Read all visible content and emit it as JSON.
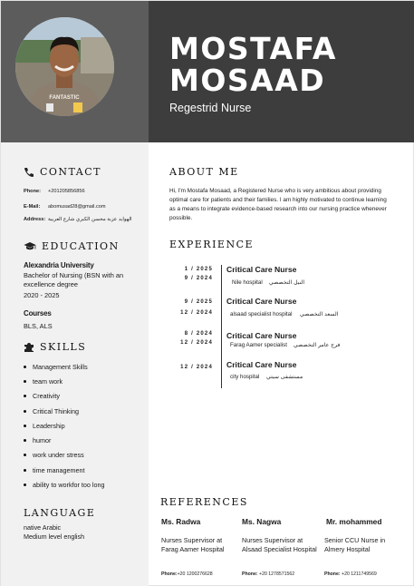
{
  "header": {
    "first_name": "MOSTAFA",
    "last_name": "MOSAAD",
    "job_title": "Regestrid Nurse",
    "photo_shirt_text": "FANTASTIC"
  },
  "contact": {
    "title": "CONTACT",
    "phone_label": "Phone:",
    "phone": "+201205856856",
    "email_label": "E-Mail:",
    "email": "abomusad28@gmail.com",
    "address_label": "Address:",
    "address": "الهوايد عزبة محسن الكبري شارع العربية"
  },
  "education": {
    "title": "EDUCATION",
    "school": "Alexandria University",
    "degree": "Bachelor of Nursing (BSN with an excellence degree",
    "years": "2020 - 2025",
    "courses_title": "Courses",
    "courses": "BLS, ALS"
  },
  "skills": {
    "title": "SKILLS",
    "items": [
      "Management Skills",
      "team work",
      "Creativity",
      "Critical Thinking",
      "Leadership",
      "humor",
      "work under stress",
      "time management",
      "ability to workfor too long"
    ]
  },
  "language": {
    "title": "LANGUAGE",
    "native": "native Arabic",
    "other": "Medium level english"
  },
  "about": {
    "title": "ABOUT ME",
    "text": "Hi, I'm Mostafa Mosaad, a Registered Nurse who is very ambitious about providing optimal care for patients and their families. I am highly motivated to continue learning as a means to integrate evidence-based research into our nursing practice whenever possible."
  },
  "experience": {
    "title": "EXPERIENCE",
    "items": [
      {
        "date1": "1 / 2025",
        "date2": "9 / 2024",
        "title": "Critical Care Nurse",
        "place_en": "Nile hospital",
        "place_ar": "النيل التخصصي"
      },
      {
        "date1": "9 / 2025",
        "date2": "12 / 2024",
        "title": "Critical Care Nurse",
        "place_en": "alsaad specialist hospital",
        "place_ar": "السعد التخصصي"
      },
      {
        "date1": "8 / 2024",
        "date2": "12 / 2024",
        "title": "Critical Care Nurse",
        "place_en": "Farag Aamer specialist",
        "place_ar": "فرج عامر التخصصي"
      },
      {
        "date1": "12 / 2024",
        "date2": "",
        "title": "Critical Care Nurse",
        "place_en": "city hospital",
        "place_ar": "مستشفى سيتي"
      }
    ]
  },
  "references": {
    "title": "REFERENCES",
    "items": [
      {
        "name": "Ms. Radwa",
        "desc": "Nurses Supervisor at Farag Aamer Hospital",
        "phone_label": "Phone:",
        "phone": "+20 1200276628"
      },
      {
        "name": "Ms. Nagwa",
        "desc": "Nurses Supervisor at Alsaad Specialist Hospital",
        "phone_label": "Phone:",
        "phone": "+20 1278571562"
      },
      {
        "name": "Mr.  mohammed",
        "desc": "Senior CCU Nurse in Almery Hospital",
        "phone_label": "Phone:",
        "phone": "+20 1211749569"
      }
    ]
  }
}
